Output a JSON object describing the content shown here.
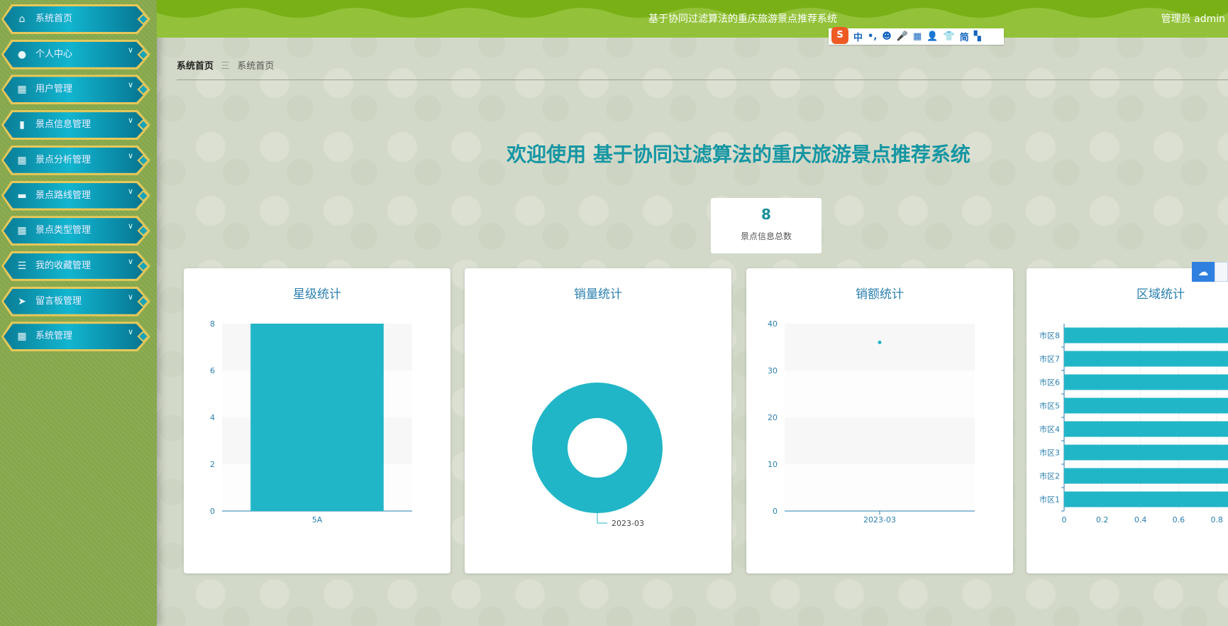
{
  "sidebar": {
    "items": [
      {
        "label": "系统首页",
        "icon": "home-icon"
      },
      {
        "label": "个人中心",
        "icon": "user-icon"
      },
      {
        "label": "用户管理",
        "icon": "grid-icon"
      },
      {
        "label": "景点信息管理",
        "icon": "bar-chart-icon"
      },
      {
        "label": "景点分析管理",
        "icon": "grid-icon"
      },
      {
        "label": "景点路线管理",
        "icon": "ticket-icon"
      },
      {
        "label": "景点类型管理",
        "icon": "grid-icon"
      },
      {
        "label": "我的收藏管理",
        "icon": "list-icon"
      },
      {
        "label": "留言板管理",
        "icon": "paper-plane-icon"
      },
      {
        "label": "系统管理",
        "icon": "grid-icon"
      }
    ]
  },
  "header": {
    "title": "基于协同过滤算法的重庆旅游景点推荐系统",
    "user": "管理员 admin"
  },
  "ime": {
    "items": [
      "中",
      "•,",
      "☻",
      "🎤",
      "▦",
      "👤",
      "👕",
      "简",
      "▚"
    ]
  },
  "breadcrumb": {
    "home": "系统首页",
    "sep": "三",
    "current": "系统首页"
  },
  "welcome": "欢迎使用 基于协同过滤算法的重庆旅游景点推荐系统",
  "stat": {
    "value": "8",
    "label": "景点信息总数"
  },
  "colors": {
    "accent": "#21b6c7",
    "axis": "#2a7fb0"
  },
  "chart_data": [
    {
      "type": "bar",
      "title": "星级统计",
      "categories": [
        "5A"
      ],
      "values": [
        8
      ],
      "ylim": [
        0,
        8
      ],
      "yticks": [
        0,
        2,
        4,
        6,
        8
      ]
    },
    {
      "type": "pie",
      "title": "销量统计",
      "categories": [
        "2023-03"
      ],
      "values": [
        1
      ],
      "donut": true
    },
    {
      "type": "scatter",
      "title": "销额统计",
      "categories": [
        "2023-03"
      ],
      "values": [
        36
      ],
      "ylim": [
        0,
        40
      ],
      "yticks": [
        0,
        10,
        20,
        30,
        40
      ]
    },
    {
      "type": "bar",
      "orientation": "horizontal",
      "title": "区域统计",
      "categories": [
        "市区1",
        "市区2",
        "市区3",
        "市区4",
        "市区5",
        "市区6",
        "市区7",
        "市区8"
      ],
      "values": [
        1,
        1,
        1,
        1,
        1,
        1,
        1,
        1
      ],
      "xlim": [
        0,
        1
      ],
      "xticks": [
        "0",
        "0.2",
        "0.4",
        "0.6",
        "0.8"
      ]
    }
  ]
}
